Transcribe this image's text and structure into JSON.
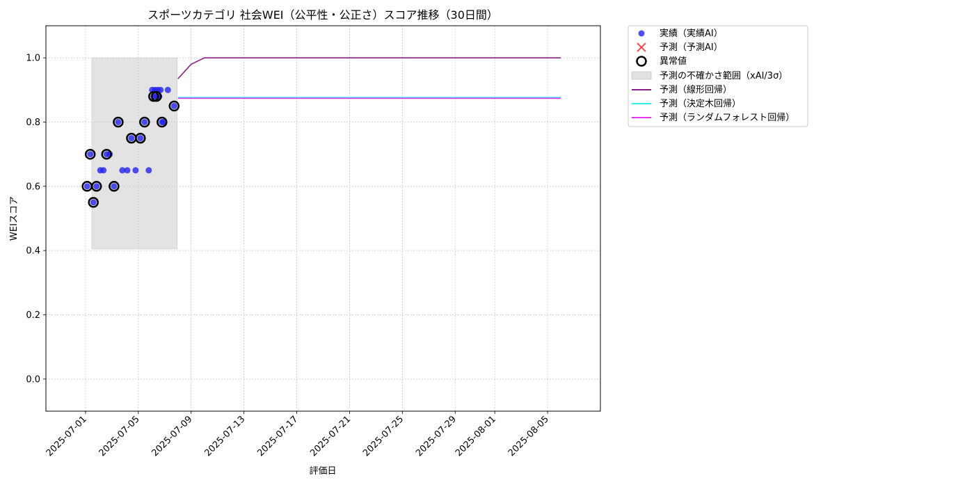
{
  "chart_data": {
    "type": "scatter",
    "title": "スポーツカテゴリ 社会WEI（公平性・公正さ）スコア推移（30日間）",
    "xlabel": "評価日",
    "ylabel": "WEIスコア",
    "xlim": [
      "2025-06-28",
      "2025-08-09"
    ],
    "ylim": [
      -0.1,
      1.1
    ],
    "grid": true,
    "legend_position": "outside-top-right",
    "x_ticks": [
      "2025-07-01",
      "2025-07-05",
      "2025-07-09",
      "2025-07-13",
      "2025-07-17",
      "2025-07-21",
      "2025-07-25",
      "2025-07-29",
      "2025-08-01",
      "2025-08-05"
    ],
    "y_ticks": [
      "0.0",
      "0.2",
      "0.4",
      "0.6",
      "0.8",
      "1.0"
    ],
    "uncertainty_band": {
      "name": "予測の不確かさ範囲（xAI/3σ）",
      "x_range": [
        "2025-07-01",
        "2025-07-07"
      ],
      "y_range": [
        0.405,
        1.0
      ],
      "color": "#d9d9d9"
    },
    "actual": {
      "name": "実績（実績AI）",
      "color": "#2222ee",
      "points": [
        [
          "2025-07-01",
          0.6
        ],
        [
          "2025-07-01",
          0.7
        ],
        [
          "2025-07-01",
          0.55
        ],
        [
          "2025-07-01",
          0.6
        ],
        [
          "2025-07-02",
          0.65
        ],
        [
          "2025-07-02",
          0.65
        ],
        [
          "2025-07-02",
          0.7
        ],
        [
          "2025-07-02",
          0.7
        ],
        [
          "2025-07-03",
          0.6
        ],
        [
          "2025-07-03",
          0.8
        ],
        [
          "2025-07-03",
          0.65
        ],
        [
          "2025-07-04",
          0.65
        ],
        [
          "2025-07-04",
          0.75
        ],
        [
          "2025-07-04",
          0.65
        ],
        [
          "2025-07-05",
          0.75
        ],
        [
          "2025-07-05",
          0.8
        ],
        [
          "2025-07-05",
          0.65
        ],
        [
          "2025-07-06",
          0.9
        ],
        [
          "2025-07-06",
          0.88
        ],
        [
          "2025-07-06",
          0.9
        ],
        [
          "2025-07-06",
          0.88
        ],
        [
          "2025-07-06",
          0.9
        ],
        [
          "2025-07-06",
          0.88
        ],
        [
          "2025-07-06",
          0.9
        ],
        [
          "2025-07-06",
          0.8
        ],
        [
          "2025-07-06",
          0.8
        ],
        [
          "2025-07-07",
          0.9
        ],
        [
          "2025-07-07",
          0.85
        ]
      ]
    },
    "anomalies": {
      "name": "異常値",
      "points": [
        [
          "2025-07-01",
          0.6
        ],
        [
          "2025-07-01",
          0.7
        ],
        [
          "2025-07-01",
          0.55
        ],
        [
          "2025-07-01",
          0.6
        ],
        [
          "2025-07-02",
          0.7
        ],
        [
          "2025-07-03",
          0.6
        ],
        [
          "2025-07-03",
          0.8
        ],
        [
          "2025-07-04",
          0.75
        ],
        [
          "2025-07-05",
          0.75
        ],
        [
          "2025-07-05",
          0.8
        ],
        [
          "2025-07-06",
          0.88
        ],
        [
          "2025-07-06",
          0.88
        ],
        [
          "2025-07-06",
          0.8
        ],
        [
          "2025-07-07",
          0.85
        ]
      ]
    },
    "forecast_marker": {
      "name": "予測（予測AI）",
      "color": "#ee3333"
    },
    "series": [
      {
        "name": "予測（線形回帰）",
        "color": "#882288",
        "x": [
          "2025-07-08",
          "2025-07-09",
          "2025-07-10",
          "2025-07-11",
          "2025-07-12",
          "2025-07-13",
          "2025-07-14",
          "2025-07-15",
          "2025-07-16",
          "2025-07-17",
          "2025-07-18",
          "2025-07-19",
          "2025-07-20",
          "2025-07-21",
          "2025-07-22",
          "2025-07-23",
          "2025-07-24",
          "2025-07-25",
          "2025-07-26",
          "2025-07-27",
          "2025-07-28",
          "2025-07-29",
          "2025-07-30",
          "2025-07-31",
          "2025-08-01",
          "2025-08-02",
          "2025-08-03",
          "2025-08-04",
          "2025-08-05",
          "2025-08-06"
        ],
        "values": [
          0.935,
          0.98,
          1.0,
          1.0,
          1.0,
          1.0,
          1.0,
          1.0,
          1.0,
          1.0,
          1.0,
          1.0,
          1.0,
          1.0,
          1.0,
          1.0,
          1.0,
          1.0,
          1.0,
          1.0,
          1.0,
          1.0,
          1.0,
          1.0,
          1.0,
          1.0,
          1.0,
          1.0,
          1.0,
          1.0
        ]
      },
      {
        "name": "予測（決定木回帰）",
        "color": "#33eeee",
        "x": [
          "2025-07-08",
          "2025-08-06"
        ],
        "values": [
          0.877,
          0.877
        ]
      },
      {
        "name": "予測（ランダムフォレスト回帰）",
        "color": "#ee33ee",
        "x": [
          "2025-07-08",
          "2025-08-06"
        ],
        "values": [
          0.874,
          0.874
        ]
      }
    ]
  }
}
